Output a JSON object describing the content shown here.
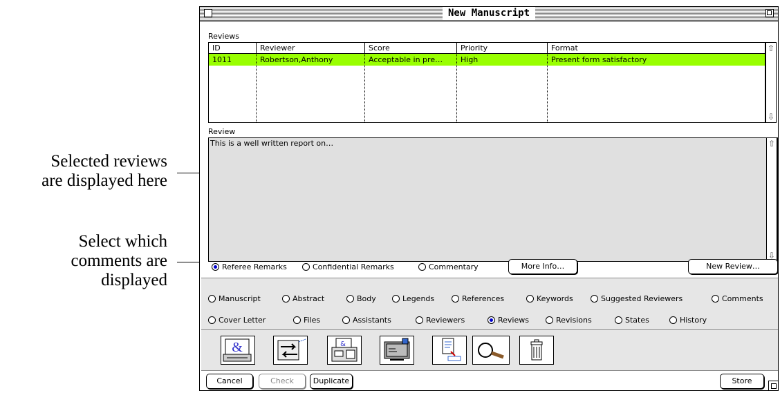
{
  "annotations": {
    "reviews_note_line1": "Selected reviews",
    "reviews_note_line2": "are displayed here",
    "comments_note_line1": "Select which",
    "comments_note_line2": "comments are",
    "comments_note_line3": "displayed"
  },
  "window": {
    "title": "New Manuscript"
  },
  "reviews": {
    "label": "Reviews",
    "columns": [
      "ID",
      "Reviewer",
      "Score",
      "Priority",
      "Format"
    ],
    "rows": [
      {
        "id": "1011",
        "reviewer": "Robertson,Anthony",
        "score": "Acceptable in pre…",
        "priority": "High",
        "format": "Present form satisfactory"
      }
    ]
  },
  "review": {
    "label": "Review",
    "text": "This is a well written report on…"
  },
  "remarks": {
    "options": [
      "Referee Remarks",
      "Confidential Remarks",
      "Commentary"
    ],
    "selected": "Referee Remarks",
    "more_info": "More Info…",
    "new_review": "New Review…"
  },
  "tabs": {
    "row1": [
      "Manuscript",
      "Abstract",
      "Body",
      "Legends",
      "References",
      "Keywords",
      "Suggested Reviewers",
      "Comments"
    ],
    "row2": [
      "Cover Letter",
      "Files",
      "Assistants",
      "Reviewers",
      "Reviews",
      "Revisions",
      "States",
      "History"
    ],
    "selected": "Reviews"
  },
  "toolbar_icons": [
    "ampersand-printer-icon",
    "transfer-arrows-icon",
    "fax-icon",
    "mail-computer-icon",
    "document-export-icon",
    "magnifier-icon",
    "trash-icon"
  ],
  "buttons": {
    "cancel": "Cancel",
    "check": "Check",
    "duplicate": "Duplicate",
    "store": "Store"
  },
  "colors": {
    "selected_row": "#99ff00",
    "radio_selected": "#0000cc"
  }
}
